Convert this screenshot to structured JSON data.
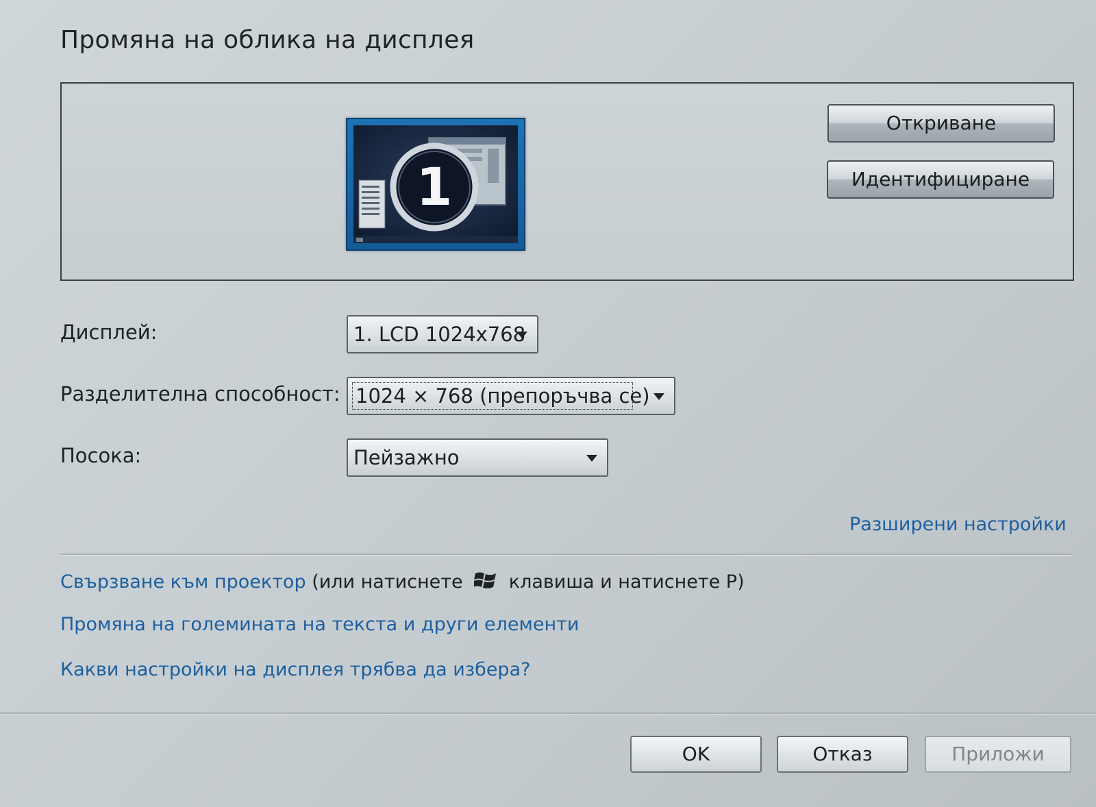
{
  "page": {
    "title": "Промяна на облика на дисплея"
  },
  "preview": {
    "monitor_number": "1",
    "detect_label": "Откриване",
    "identify_label": "Идентифициране"
  },
  "settings": {
    "display": {
      "label": "Дисплей:",
      "value": "1. LCD 1024x768"
    },
    "resolution": {
      "label": "Разделителна способност:",
      "value": "1024 × 768 (препоръчва се)"
    },
    "orientation": {
      "label": "Посока:",
      "value": "Пейзажно"
    }
  },
  "links": {
    "advanced": "Разширени настройки",
    "projector": "Свързване към проектор",
    "projector_hint_before": "(или натиснете",
    "projector_hint_after": "клавиша и натиснете P)",
    "text_size": "Промяна на големината на текста и други елементи",
    "which_settings": "Какви настройки на дисплея трябва да избера?"
  },
  "footer": {
    "ok_label": "OK",
    "cancel_label": "Отказ",
    "apply_label": "Приложи"
  },
  "icons": {
    "windows_key": "windows-logo-icon",
    "dropdown": "chevron-down-icon"
  },
  "colors": {
    "link": "#1d5f9e",
    "monitor_frame": "#1d73b5",
    "disabled_text": "#7f878c"
  }
}
